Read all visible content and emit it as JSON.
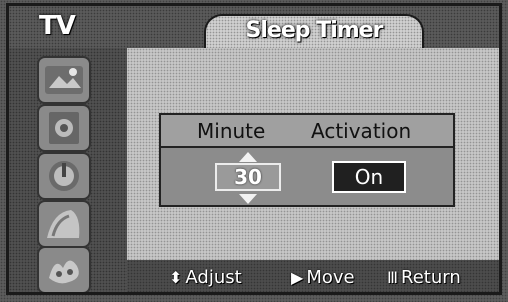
{
  "header": {
    "menu_title": "TV",
    "screen_title": "Sleep Timer"
  },
  "sidebar": {
    "items": [
      {
        "icon": "picture-icon"
      },
      {
        "icon": "sound-icon"
      },
      {
        "icon": "channel-icon"
      },
      {
        "icon": "setup-icon"
      },
      {
        "icon": "input-icon"
      }
    ]
  },
  "sleep_timer": {
    "minute_label": "Minute",
    "activation_label": "Activation",
    "minute_value": "30",
    "activation_value": "On"
  },
  "help": {
    "adjust_glyph": "⬍",
    "adjust_label": "Adjust",
    "move_glyph": "▶",
    "move_label": "Move",
    "return_glyph": "Ⅲ",
    "return_label": "Return"
  },
  "colors": {
    "panel": "#c6c6c6",
    "sidebar": "#505050",
    "selected_field": "#202020",
    "text": "#ffffff"
  }
}
